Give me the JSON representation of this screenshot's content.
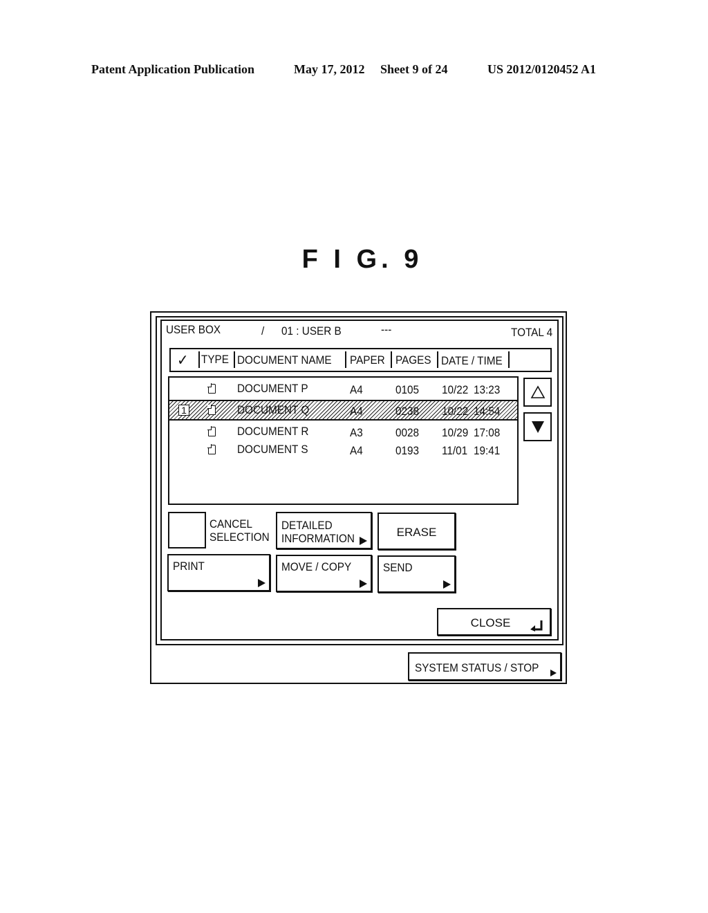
{
  "patent_header": {
    "publication": "Patent Application Publication",
    "date": "May 17, 2012",
    "sheet": "Sheet 9 of 24",
    "number": "US 2012/0120452 A1"
  },
  "figure_title": "F I G. 9",
  "screen": {
    "title_bar": {
      "box_label": "USER BOX",
      "separator": "/",
      "user": "01 : USER B",
      "placeholder": "---",
      "total": "TOTAL 4"
    },
    "columns": {
      "check": "✓",
      "type": "TYPE",
      "document_name": "DOCUMENT NAME",
      "paper": "PAPER",
      "pages": "PAGES",
      "date_time": "DATE / TIME"
    },
    "documents": [
      {
        "selected_index": "",
        "type_icon": "document-icon",
        "name": "DOCUMENT P",
        "paper": "A4",
        "pages": "0105",
        "date": "10/22",
        "time": "13:23",
        "selected": false
      },
      {
        "selected_index": "1",
        "type_icon": "document-icon",
        "name": "DOCUMENT Q",
        "paper": "A4",
        "pages": "0238",
        "date": "10/22",
        "time": "14:54",
        "selected": true
      },
      {
        "selected_index": "",
        "type_icon": "document-icon",
        "name": "DOCUMENT R",
        "paper": "A3",
        "pages": "0028",
        "date": "10/29",
        "time": "17:08",
        "selected": false
      },
      {
        "selected_index": "",
        "type_icon": "document-icon",
        "name": "DOCUMENT S",
        "paper": "A4",
        "pages": "0193",
        "date": "11/01",
        "time": "19:41",
        "selected": false
      }
    ],
    "scroll": {
      "up_icon": "triangle-up-outline-icon",
      "down_icon": "triangle-down-filled-icon"
    },
    "buttons": {
      "cancel_selection_line1": "CANCEL",
      "cancel_selection_line2": "SELECTION",
      "detailed_info_line1": "DETAILED",
      "detailed_info_line2": "INFORMATION",
      "erase": "ERASE",
      "print": "PRINT",
      "move_copy": "MOVE / COPY",
      "send": "SEND",
      "close": "CLOSE",
      "system_status": "SYSTEM  STATUS / STOP"
    }
  }
}
